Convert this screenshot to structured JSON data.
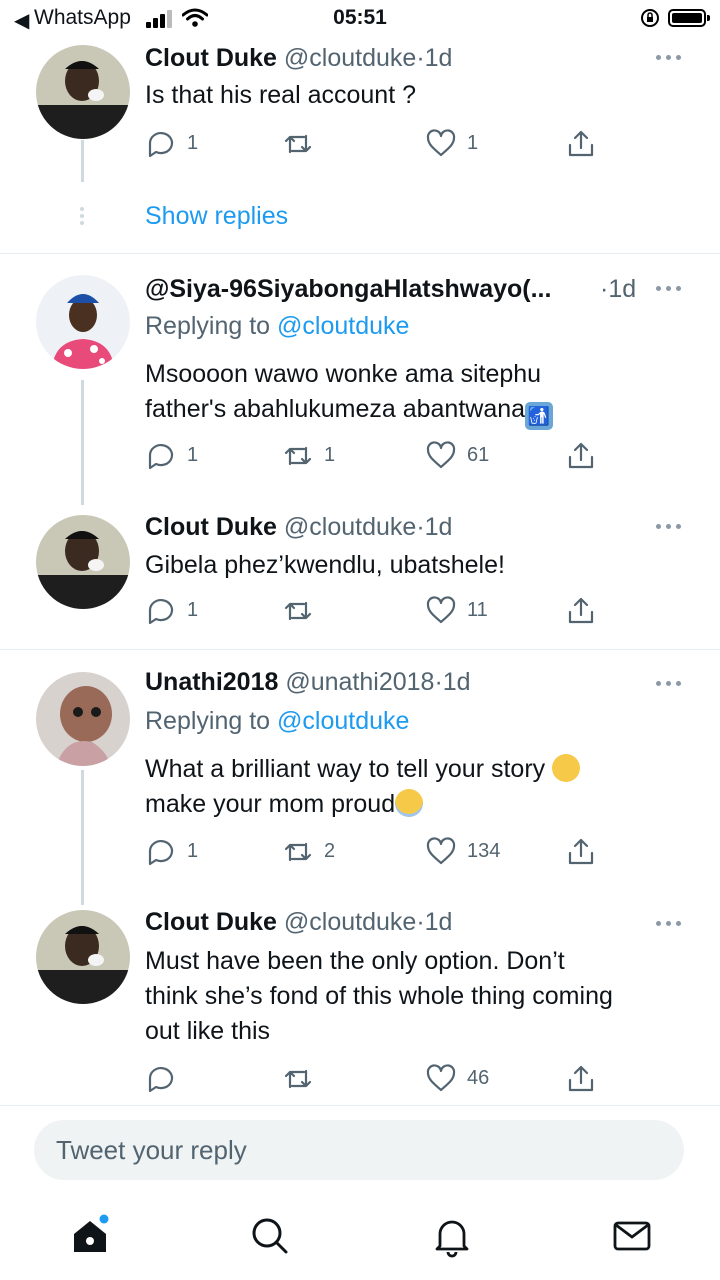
{
  "status_bar": {
    "back_app": "WhatsApp",
    "time": "05:51"
  },
  "tweets": [
    {
      "name": "Clout Duke",
      "handle": "@cloutduke",
      "time": "1d",
      "text": "Is that his real account ?",
      "replies": "1",
      "retweets": "",
      "likes": "1",
      "avatar": "clout-duke"
    },
    {
      "name": "@Siya-96SiyabongaHlatshwayo(...",
      "handle": "",
      "time": "1d",
      "replying_label": "Replying to ",
      "replying_to": "@cloutduke",
      "text_line1": "Msoooon wawo wonke ama sitephu",
      "text_line2": "father's abahlukumeza abantwana",
      "emoji": "put-litter-in-its-place",
      "replies": "1",
      "retweets": "1",
      "likes": "61",
      "avatar": "siya"
    },
    {
      "name": "Clout Duke",
      "handle": "@cloutduke",
      "time": "1d",
      "text": "Gibela phez’kwendlu, ubatshele!",
      "replies": "1",
      "retweets": "",
      "likes": "11",
      "avatar": "clout-duke"
    },
    {
      "name": "Unathi2018",
      "handle": "@unathi2018",
      "time": "1d",
      "replying_label": "Replying to ",
      "replying_to": "@cloutduke",
      "text_line1": "What a brilliant way to tell your story",
      "text_line2": "make your mom proud",
      "emoji1": "ok-hand",
      "emoji2": "smiling-face-with-halo",
      "replies": "1",
      "retweets": "2",
      "likes": "134",
      "avatar": "unathi"
    },
    {
      "name": "Clout Duke",
      "handle": "@cloutduke",
      "time": "1d",
      "text_line1": "Must have been the only option. Don’t",
      "text_line2": "think she’s fond of this whole thing coming",
      "text_line3": "out like this",
      "replies": "",
      "retweets": "",
      "likes": "46",
      "avatar": "clout-duke"
    }
  ],
  "show_replies_label": "Show replies",
  "dot_separator": "·",
  "reply_box": {
    "placeholder": "Tweet your reply"
  },
  "tabbar": [
    "home-icon",
    "search-icon",
    "notifications-icon",
    "messages-icon"
  ],
  "colors": {
    "link": "#1d9bf0",
    "muted": "#536471",
    "divider": "#e6ecf0"
  }
}
